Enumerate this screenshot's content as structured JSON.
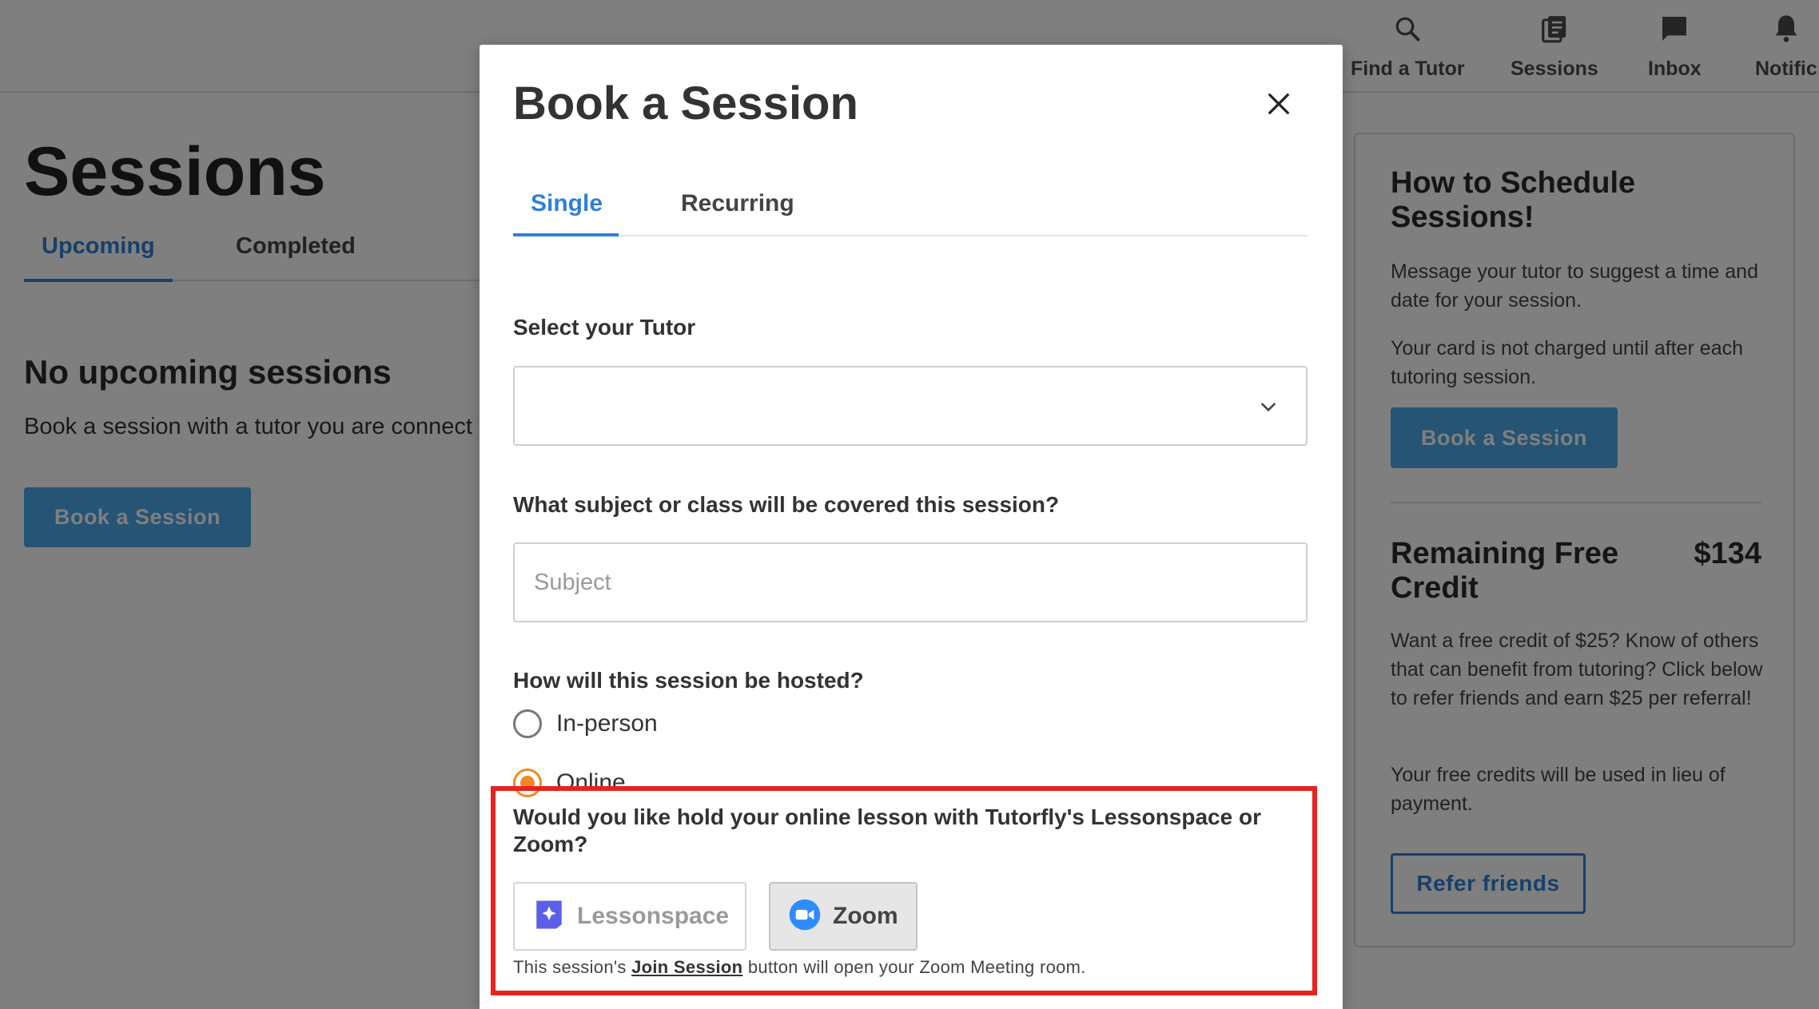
{
  "nav": {
    "items": [
      {
        "label": "Find a Tutor",
        "icon": "search-icon"
      },
      {
        "label": "Sessions",
        "icon": "sessions-icon"
      },
      {
        "label": "Inbox",
        "icon": "inbox-icon"
      },
      {
        "label": "Notific",
        "icon": "bell-icon"
      }
    ]
  },
  "page": {
    "title": "Sessions",
    "tabs": [
      {
        "label": "Upcoming",
        "active": true
      },
      {
        "label": "Completed",
        "active": false
      }
    ],
    "empty_title": "No upcoming sessions",
    "empty_text": "Book a session with a tutor you are connect",
    "book_button": "Book a Session"
  },
  "panel": {
    "title": "How to Schedule Sessions!",
    "text1": "Message your tutor to suggest a time and date for your session.",
    "text2": "Your card is not charged until after each tutoring session.",
    "book_button": "Book a Session",
    "credit_title": "Remaining Free Credit",
    "credit_amount": "$134",
    "text3": "Want a free credit of $25? Know of others that can benefit from tutoring? Click below to refer friends and earn $25 per referral!",
    "text4": "Your free credits will be used in lieu of payment.",
    "refer_button": "Refer friends"
  },
  "modal": {
    "title": "Book a Session",
    "tabs": [
      {
        "label": "Single",
        "active": true
      },
      {
        "label": "Recurring",
        "active": false
      }
    ],
    "tutor_label": "Select your Tutor",
    "tutor_value": "",
    "subject_label": "What subject or class will be covered this session?",
    "subject_placeholder": "Subject",
    "subject_value": "",
    "host_label": "How will this session be hosted?",
    "host_options": [
      {
        "label": "In-person",
        "checked": false
      },
      {
        "label": "Online",
        "checked": true
      }
    ],
    "platform_question": "Would you like hold your online lesson with Tutorfly's Lessonspace or Zoom?",
    "platforms": [
      {
        "label": "Lessonspace",
        "icon": "lessonspace-icon",
        "selected": false
      },
      {
        "label": "Zoom",
        "icon": "zoom-icon",
        "selected": true
      }
    ],
    "note_prefix": "This session's ",
    "note_link": "Join Session",
    "note_suffix": " button will open your Zoom Meeting room."
  },
  "colors": {
    "accent_blue": "#2f80d3",
    "button_blue": "#4aa8e8",
    "radio_orange": "#f08a24",
    "highlight_red": "#e8231f",
    "lessonspace_purple": "#5b5fe8",
    "zoom_blue": "#2d8cff"
  }
}
